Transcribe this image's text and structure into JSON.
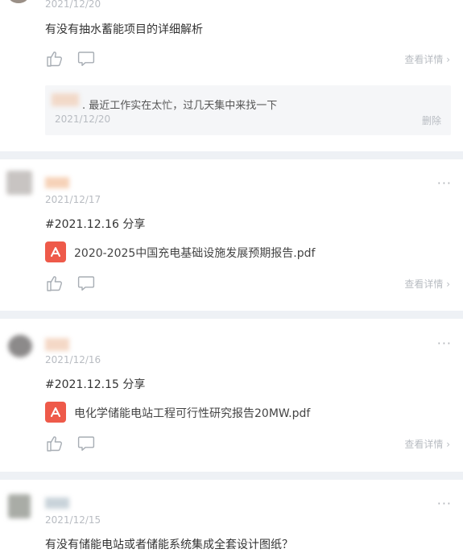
{
  "colors": {
    "accent_pdf": "#ee5a4a",
    "separator": "#eef1f5",
    "muted_text": "#b8bcc2",
    "reply_bg": "#f5f6f8"
  },
  "post1": {
    "date": "2021/12/20",
    "text": "有没有抽水蓄能项目的详细解析",
    "detail_label": "查看详情",
    "reply": {
      "text": ". 最近工作实在太忙，过几天集中来找一下",
      "date": "2021/12/20",
      "delete_label": "删除"
    }
  },
  "post2": {
    "date": "2021/12/17",
    "text": "#2021.12.16 分享",
    "file_name": "2020-2025中国充电基础设施发展预期报告.pdf",
    "detail_label": "查看详情",
    "more": "···"
  },
  "post3": {
    "date": "2021/12/16",
    "text": "#2021.12.15 分享",
    "file_name": "电化学储能电站工程可行性研究报告20MW.pdf",
    "detail_label": "查看详情",
    "more": "···"
  },
  "post4": {
    "date": "2021/12/15",
    "text": "有没有储能电站或者储能系统集成全套设计图纸？",
    "more": "···"
  },
  "icons": [
    "thumbs-up-icon",
    "comment-icon",
    "chevron-right-icon",
    "pdf-file-icon",
    "more-icon"
  ]
}
